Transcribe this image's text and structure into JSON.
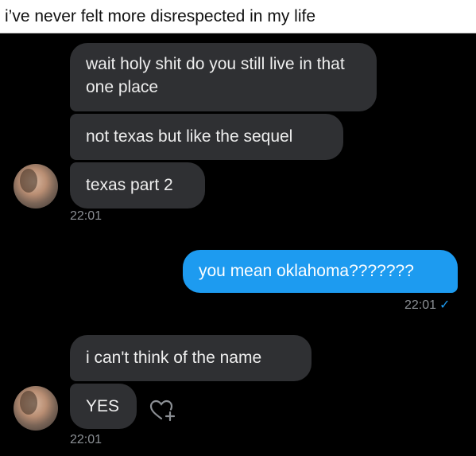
{
  "caption": "i’ve never felt more disrespected in my life",
  "incoming": [
    "wait holy shit do you still live in that one place",
    "not texas but like the sequel",
    "texas part 2",
    "i can't think of the name",
    "YES"
  ],
  "outgoing": [
    "you mean oklahoma???????"
  ],
  "timestamps": [
    "22:01",
    "22:01",
    "22:01"
  ],
  "read_check": "✓",
  "icons": {
    "avatar": "profile-avatar",
    "reaction": "heart-plus-icon"
  },
  "colors": {
    "incoming_bubble": "#2f3033",
    "outgoing_bubble": "#1d9bf0",
    "timestamp": "#8b8f94"
  }
}
